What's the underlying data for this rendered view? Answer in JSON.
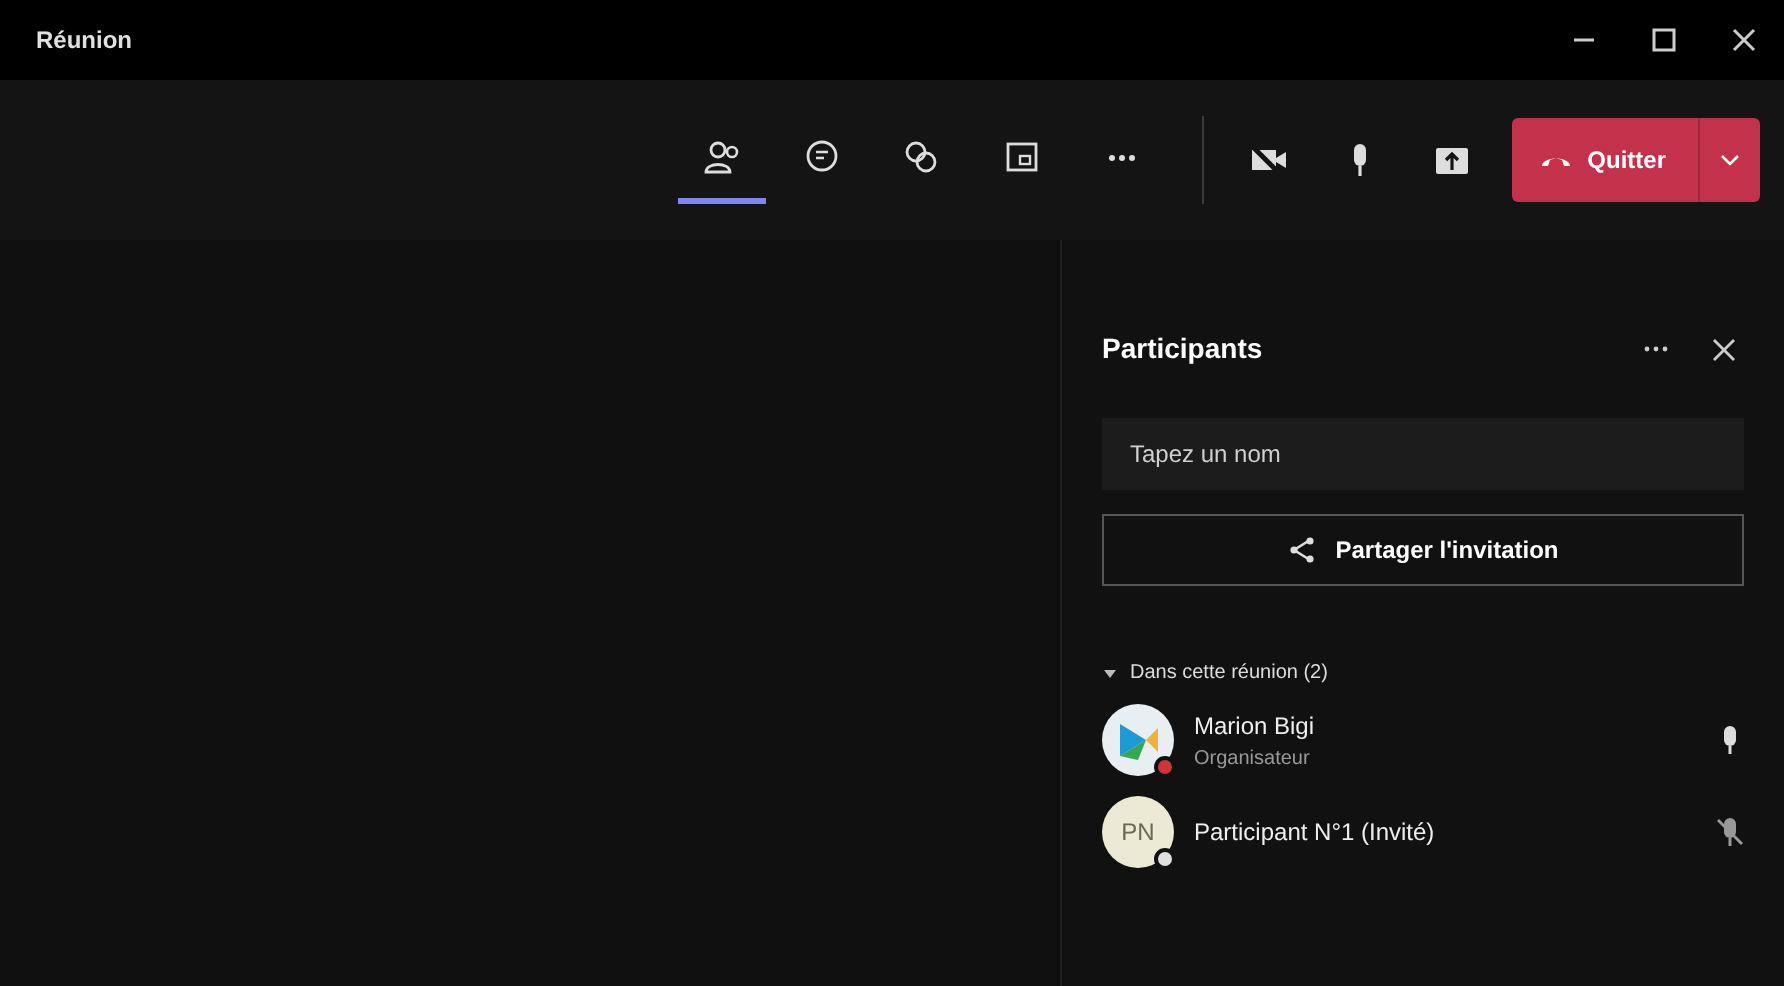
{
  "window": {
    "title": "Réunion"
  },
  "toolbar": {
    "tabs": [
      {
        "kind": "people",
        "selected": true
      },
      {
        "kind": "chat",
        "selected": false
      },
      {
        "kind": "reactions",
        "selected": false
      },
      {
        "kind": "rooms",
        "selected": false
      },
      {
        "kind": "more",
        "selected": false
      }
    ],
    "controls": [
      {
        "kind": "camera_off"
      },
      {
        "kind": "mic"
      },
      {
        "kind": "share"
      }
    ],
    "leave_button": {
      "label": "Quitter"
    }
  },
  "panel": {
    "title": "Participants",
    "search": {
      "placeholder": "Tapez un nom"
    },
    "invite_button": {
      "label": "Partager l'invitation"
    },
    "section": {
      "label": "Dans cette réunion (2)",
      "expanded": true,
      "participants": [
        {
          "name": "Marion Bigi",
          "role": "Organisateur",
          "kind": "picture",
          "color": "#d13438",
          "muted": false
        },
        {
          "name": "Participant N°1 (Invité)",
          "initials": "PN",
          "kind": "initials",
          "color": "#e0e0e0",
          "muted": true
        }
      ]
    }
  }
}
